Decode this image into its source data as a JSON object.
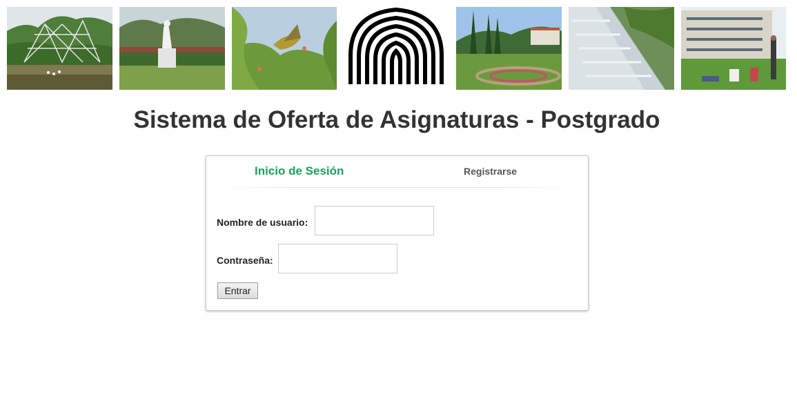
{
  "header": {
    "photos": [
      {
        "name": "sculpture-garden-photo",
        "icon": "lake-sculpture-image"
      },
      {
        "name": "statue-photo",
        "icon": "white-statue-image"
      },
      {
        "name": "bird-photo",
        "icon": "bird-on-branch-image"
      },
      {
        "name": "gardens-photo",
        "icon": "campus-garden-image"
      },
      {
        "name": "fountain-photo",
        "icon": "cascade-fountain-image"
      },
      {
        "name": "students-photo",
        "icon": "students-lawn-image"
      }
    ],
    "logo_icon": "university-logo"
  },
  "title": "Sistema de Oferta de Asignaturas - Postgrado",
  "tabs": {
    "login": "Inicio de Sesión",
    "register": "Registrarse",
    "active": "login"
  },
  "form": {
    "username_label": "Nombre de usuario:",
    "username_value": "",
    "password_label": "Contraseña:",
    "password_value": "",
    "submit_label": "Entrar"
  },
  "colors": {
    "active_tab": "#16a35c",
    "inactive_tab": "#555555",
    "title": "#333333"
  }
}
